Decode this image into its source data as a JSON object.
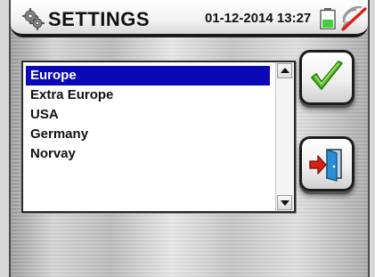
{
  "header": {
    "icon": "gear-icon",
    "title": "SETTINGS",
    "datetime": "01-12-2014 13:27",
    "battery_icon": "battery-icon",
    "signal_icon": "no-signal-icon"
  },
  "list": {
    "items": [
      {
        "label": "Europe",
        "selected": true
      },
      {
        "label": "Extra Europe",
        "selected": false
      },
      {
        "label": "USA",
        "selected": false
      },
      {
        "label": "Germany",
        "selected": false
      },
      {
        "label": "Norvay",
        "selected": false
      }
    ],
    "scroll_up_icon": "arrow-up-icon",
    "scroll_down_icon": "arrow-down-icon"
  },
  "buttons": {
    "confirm_icon": "checkmark-icon",
    "exit_icon": "exit-door-icon"
  },
  "colors": {
    "selection": "#0b08b8",
    "check_green": "#5cc22e",
    "exit_red": "#d8201a",
    "door_blue": "#2a8fd6",
    "battery_green": "#3fd13a"
  }
}
